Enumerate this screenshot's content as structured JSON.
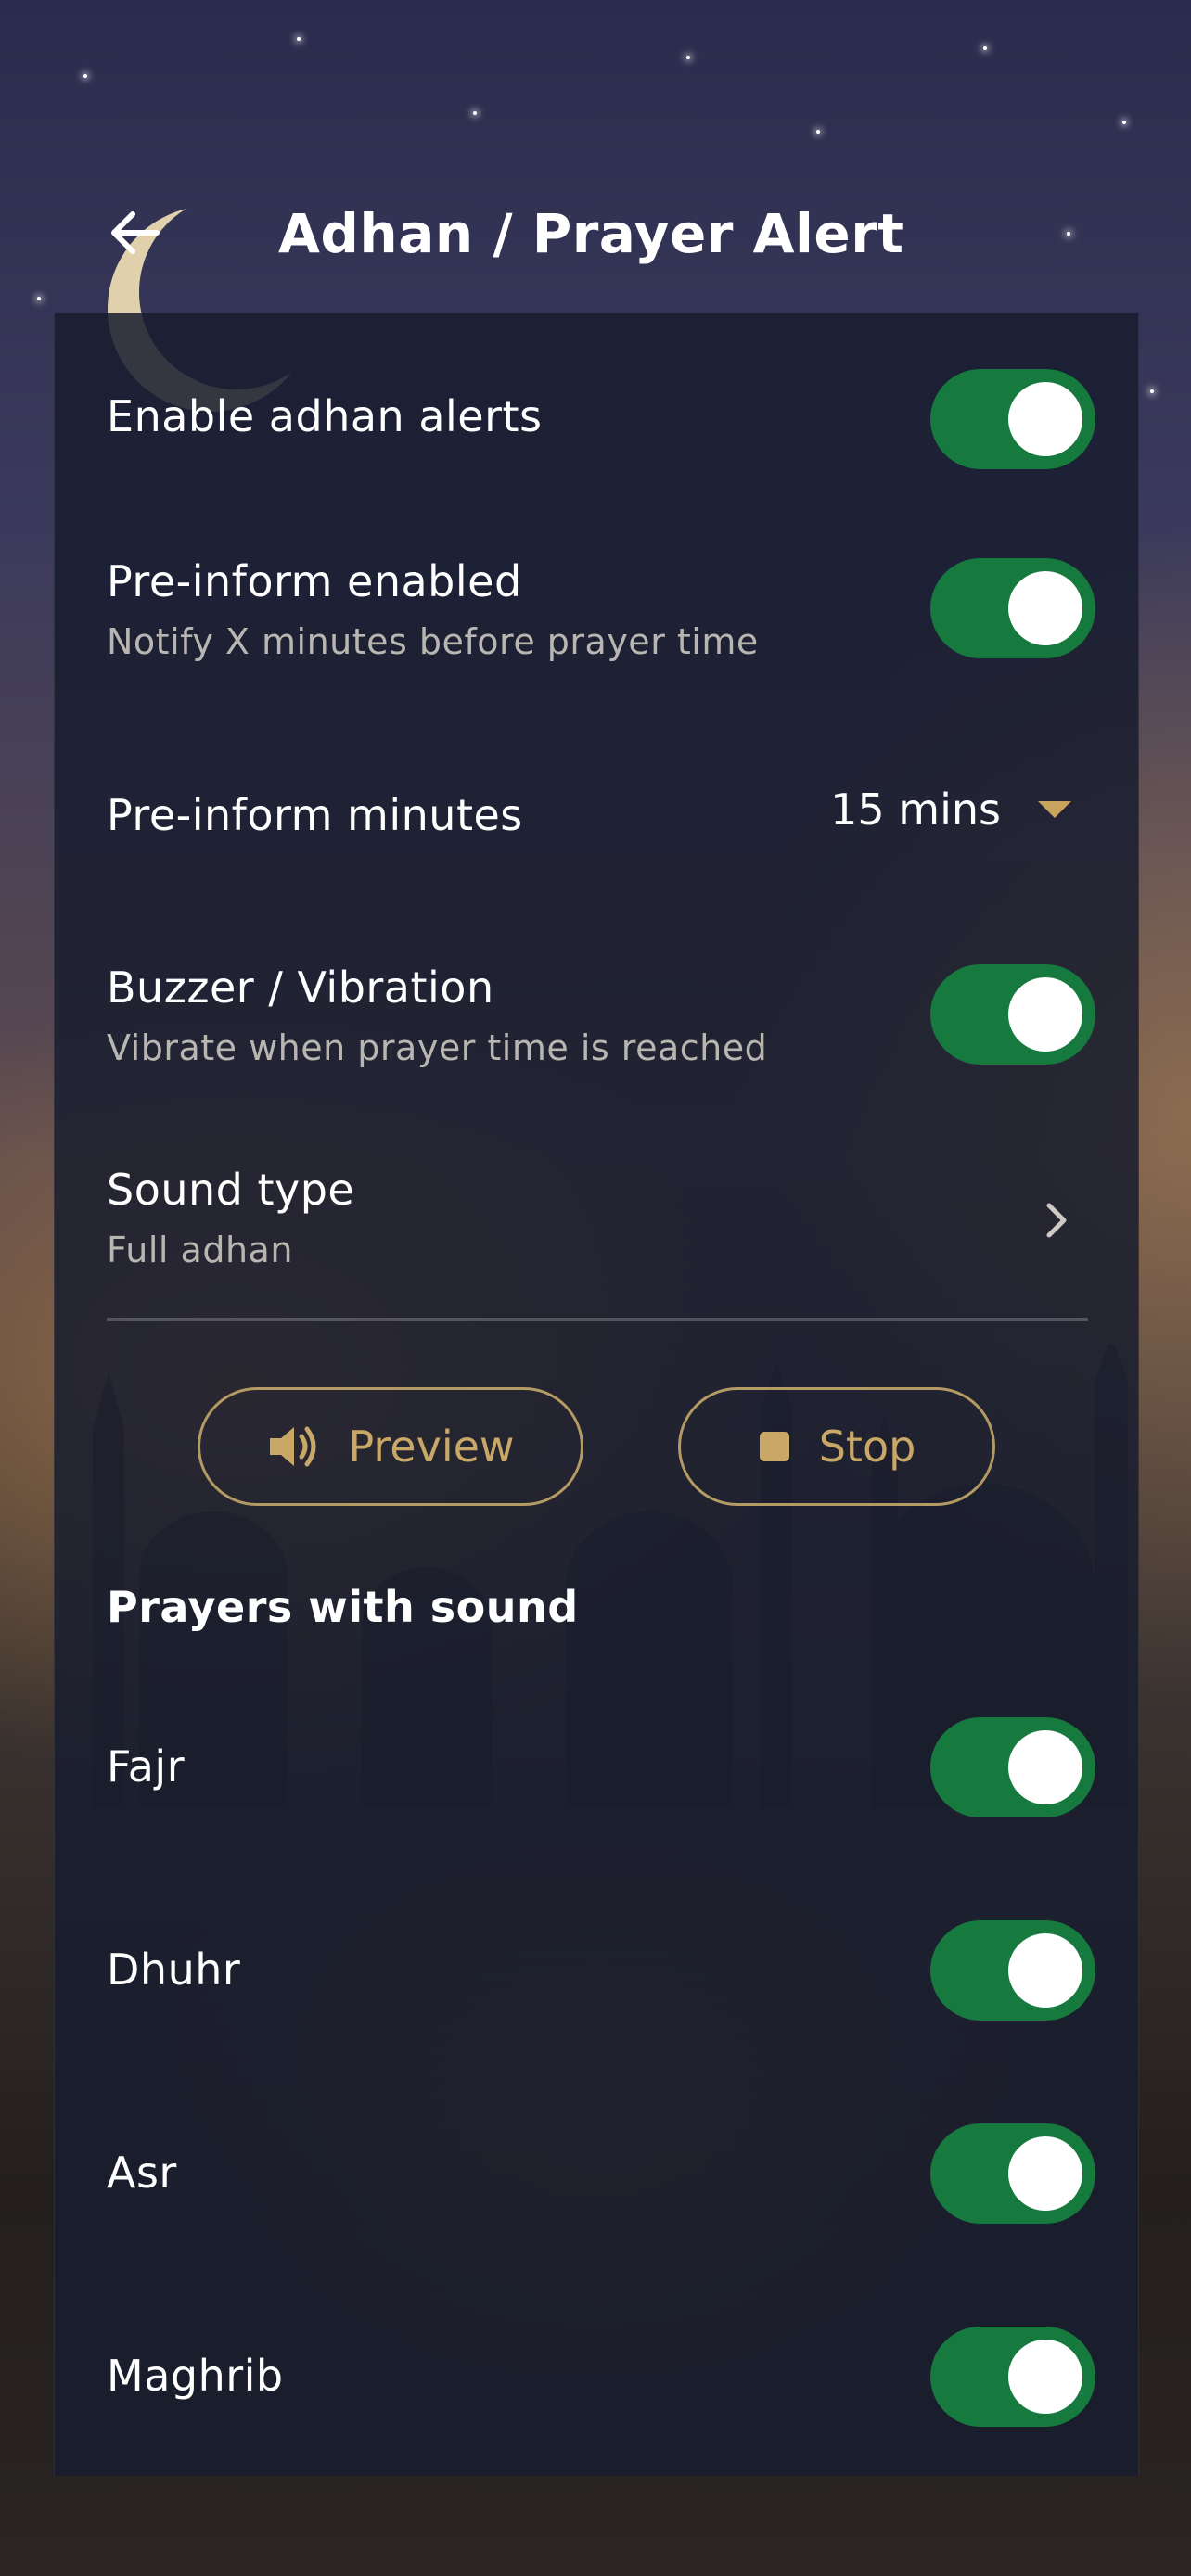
{
  "header": {
    "title": "Adhan / Prayer Alert",
    "back_icon": "arrow-left-icon"
  },
  "settings": {
    "enable_alerts": {
      "label": "Enable adhan alerts",
      "on": true
    },
    "pre_inform": {
      "label": "Pre-inform enabled",
      "sub": "Notify X minutes before prayer time",
      "on": true
    },
    "pre_inform_minutes": {
      "label": "Pre-inform minutes",
      "value": "15 mins"
    },
    "buzzer": {
      "label": "Buzzer / Vibration",
      "sub": "Vibrate when prayer time is reached",
      "on": true
    },
    "sound_type": {
      "label": "Sound type",
      "value": "Full adhan"
    }
  },
  "actions": {
    "preview_label": "Preview",
    "stop_label": "Stop",
    "preview_icon": "speaker-icon",
    "stop_icon": "stop-icon"
  },
  "prayers": {
    "title": "Prayers with sound",
    "items": [
      {
        "name": "Fajr",
        "on": true
      },
      {
        "name": "Dhuhr",
        "on": true
      },
      {
        "name": "Asr",
        "on": true
      },
      {
        "name": "Maghrib",
        "on": true
      }
    ]
  },
  "colors": {
    "toggle_on": "#167a3e",
    "accent_gold": "#c9a867",
    "panel_bg": "#181d2e"
  }
}
